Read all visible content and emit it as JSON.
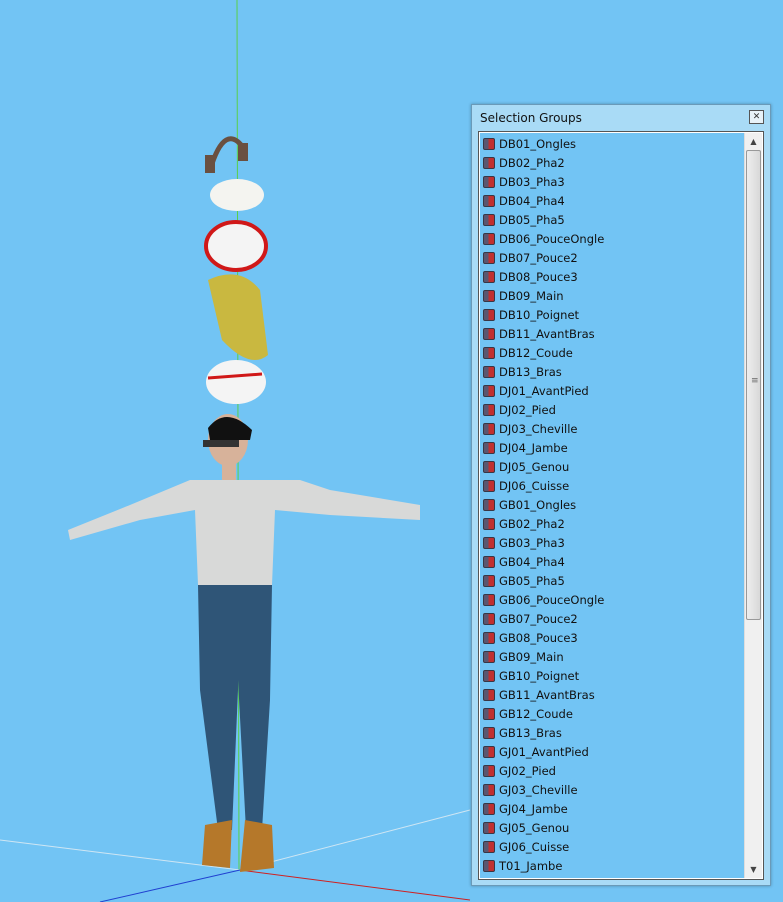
{
  "panel": {
    "title": "Selection Groups",
    "close_icon": "close-icon"
  },
  "items": [
    "DB01_Ongles",
    "DB02_Pha2",
    "DB03_Pha3",
    "DB04_Pha4",
    "DB05_Pha5",
    "DB06_PouceOngle",
    "DB07_Pouce2",
    "DB08_Pouce3",
    "DB09_Main",
    "DB10_Poignet",
    "DB11_AvantBras",
    "DB12_Coude",
    "DB13_Bras",
    "DJ01_AvantPied",
    "DJ02_Pied",
    "DJ03_Cheville",
    "DJ04_Jambe",
    "DJ05_Genou",
    "DJ06_Cuisse",
    "GB01_Ongles",
    "GB02_Pha2",
    "GB03_Pha3",
    "GB04_Pha4",
    "GB05_Pha5",
    "GB06_PouceOngle",
    "GB07_Pouce2",
    "GB08_Pouce3",
    "GB09_Main",
    "GB10_Poignet",
    "GB11_AvantBras",
    "GB12_Coude",
    "GB13_Bras",
    "GJ01_AvantPied",
    "GJ02_Pied",
    "GJ03_Cheville",
    "GJ04_Jambe",
    "GJ05_Genou",
    "GJ06_Cuisse",
    "T01_Jambe"
  ],
  "colors": {
    "background": "#72c4f4",
    "panel": "#a9dbf6"
  }
}
